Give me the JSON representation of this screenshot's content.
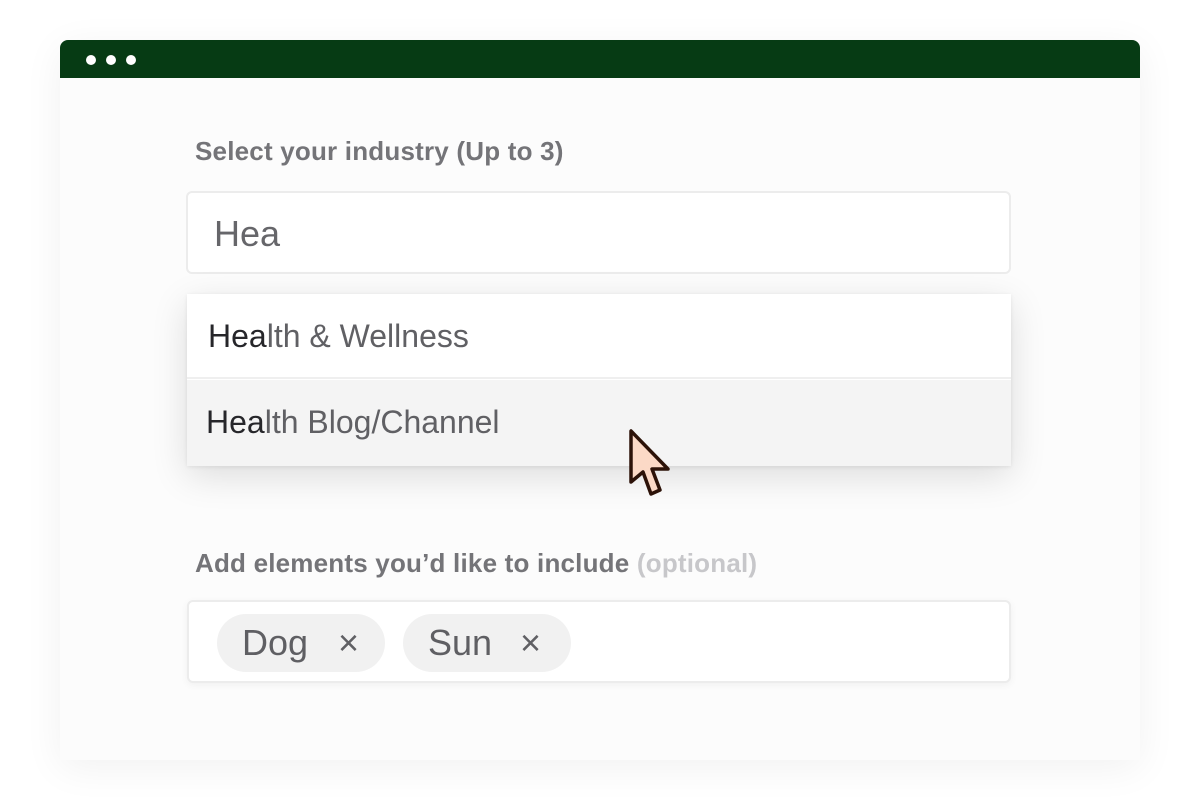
{
  "window": {
    "titlebar_color": "#063b14",
    "controls": [
      "dot",
      "dot",
      "dot"
    ]
  },
  "industry": {
    "label": "Select your industry (Up to 3)",
    "input_value": "Hea",
    "options": [
      {
        "match": "Hea",
        "rest": "lth & Wellness"
      },
      {
        "match": "Hea",
        "rest": "lth Blog/Channel"
      }
    ],
    "hovered_option": "Health Blog/Channel"
  },
  "elements": {
    "label": "Add elements you’d like to include",
    "optional_note": "(optional)",
    "tags": [
      {
        "label": "Dog",
        "remove": "×"
      },
      {
        "label": "Sun",
        "remove": "×"
      }
    ]
  },
  "icons": {
    "cursor": "pointer-arrow-icon",
    "remove": "close-icon"
  }
}
